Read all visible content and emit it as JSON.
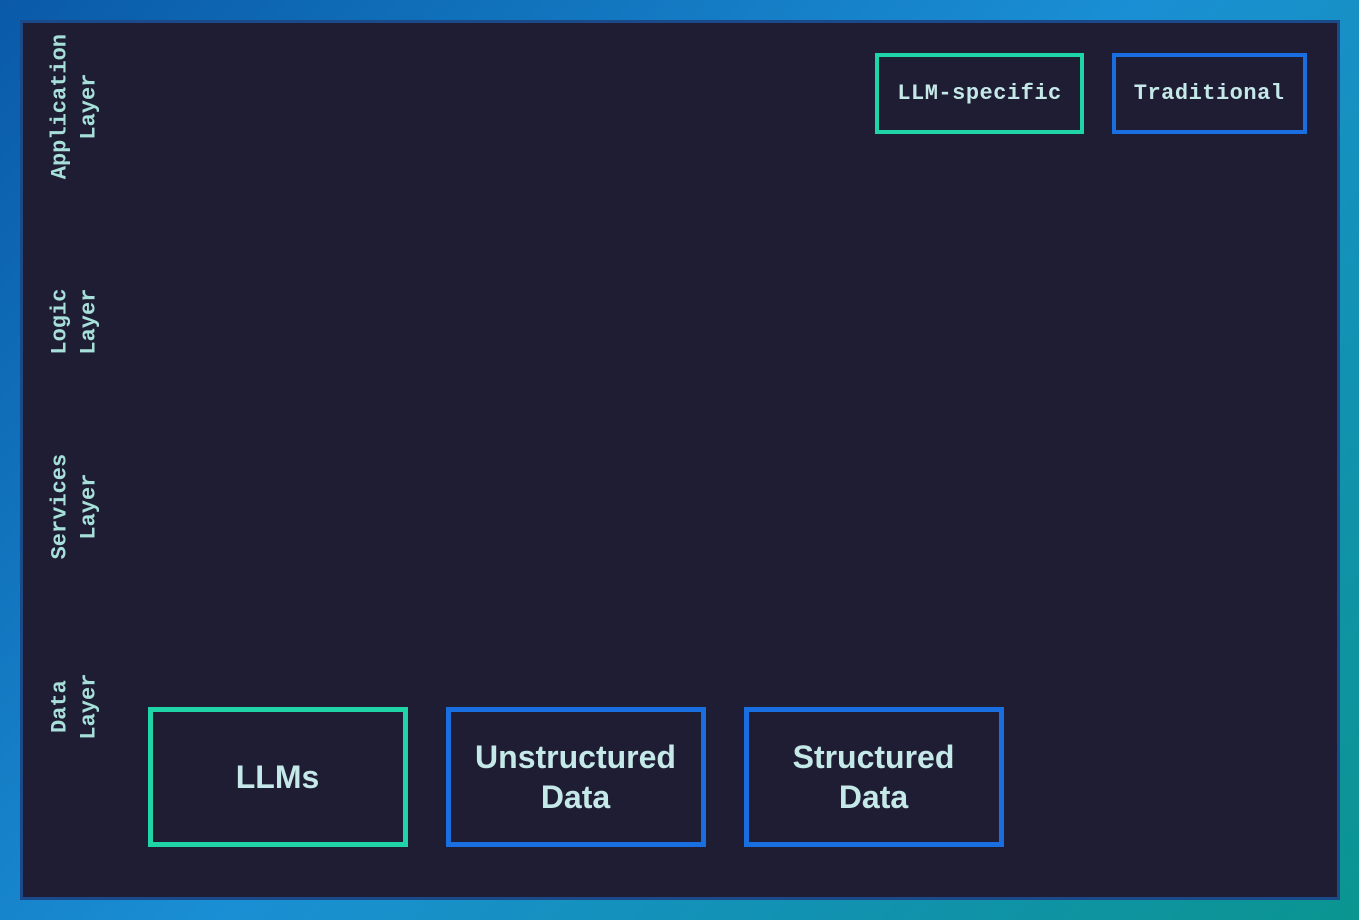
{
  "legend": {
    "llm_specific": "LLM-specific",
    "traditional": "Traditional"
  },
  "layers": {
    "application": "Application\nLayer",
    "logic": "Logic\nLayer",
    "services": "Services\nLayer",
    "data": "Data\nLayer"
  },
  "data_boxes": {
    "llms": "LLMs",
    "unstructured": "Unstructured\nData",
    "structured": "Structured\nData"
  },
  "colors": {
    "llm_specific_border": "#1fd4a7",
    "traditional_border": "#1a6fe0",
    "background": "#1f1d33",
    "text": "#c5e8e8",
    "label_text": "#a7e0da"
  }
}
